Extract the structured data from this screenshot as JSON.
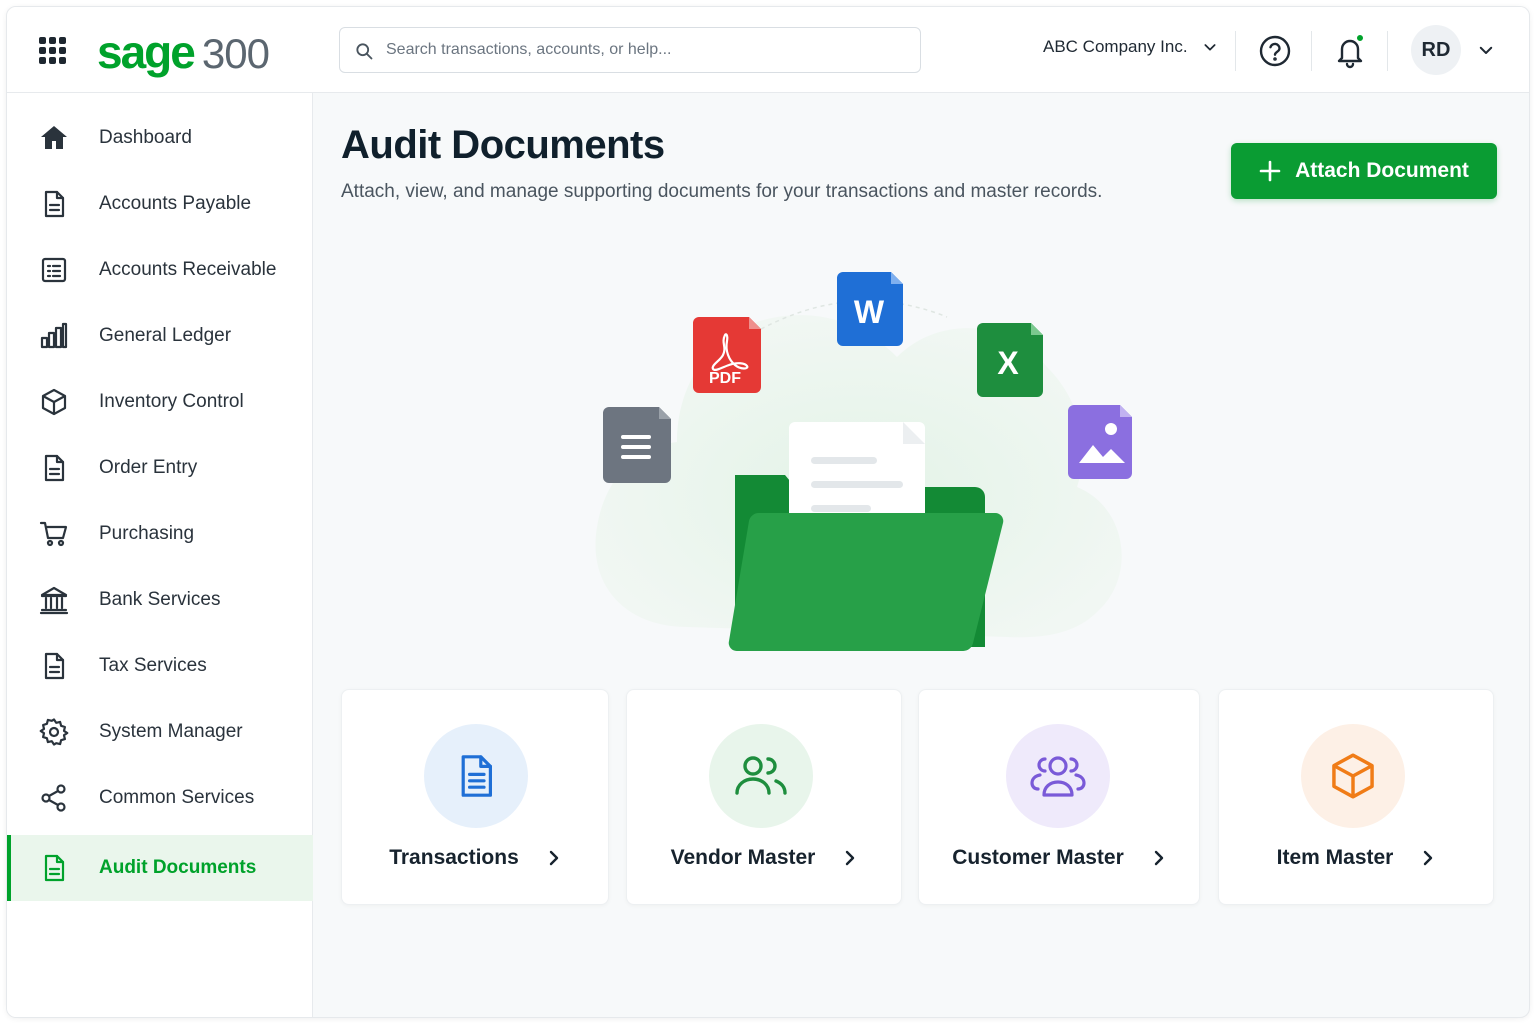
{
  "header": {
    "brand_name": "sage",
    "brand_number": "300",
    "search_placeholder": "Search transactions, accounts, or help...",
    "company": "ABC Company Inc.",
    "user_initials": "RD"
  },
  "sidebar": {
    "items": [
      {
        "label": "Dashboard",
        "icon": "home-icon"
      },
      {
        "label": "Accounts Payable",
        "icon": "document-icon"
      },
      {
        "label": "Accounts Receivable",
        "icon": "receivable-icon"
      },
      {
        "label": "General Ledger",
        "icon": "chart-icon"
      },
      {
        "label": "Inventory Control",
        "icon": "cube-icon"
      },
      {
        "label": "Order Entry",
        "icon": "document-icon"
      },
      {
        "label": "Purchasing",
        "icon": "cart-icon"
      },
      {
        "label": "Bank Services",
        "icon": "bank-icon"
      },
      {
        "label": "Tax Services",
        "icon": "document-icon"
      },
      {
        "label": "System Manager",
        "icon": "gear-icon"
      },
      {
        "label": "Common Services",
        "icon": "share-icon"
      },
      {
        "label": "Audit Documents",
        "icon": "document-icon",
        "active": true
      }
    ]
  },
  "main": {
    "title": "Audit Documents",
    "subtitle": "Attach, view, and manage supporting documents for your transactions and master records.",
    "attach_button": "Attach Document",
    "illustration": {
      "word_letter": "W",
      "excel_letter": "X",
      "pdf_label": "PDF"
    },
    "cards": [
      {
        "label": "Transactions",
        "icon": "document-icon"
      },
      {
        "label": "Vendor Master",
        "icon": "users-icon"
      },
      {
        "label": "Customer Master",
        "icon": "users-icon"
      },
      {
        "label": "Item Master",
        "icon": "cube-icon"
      }
    ]
  },
  "colors": {
    "brand_green": "#00a22b",
    "button_green": "#0a9c33",
    "active_bg": "#eaf6ec"
  }
}
